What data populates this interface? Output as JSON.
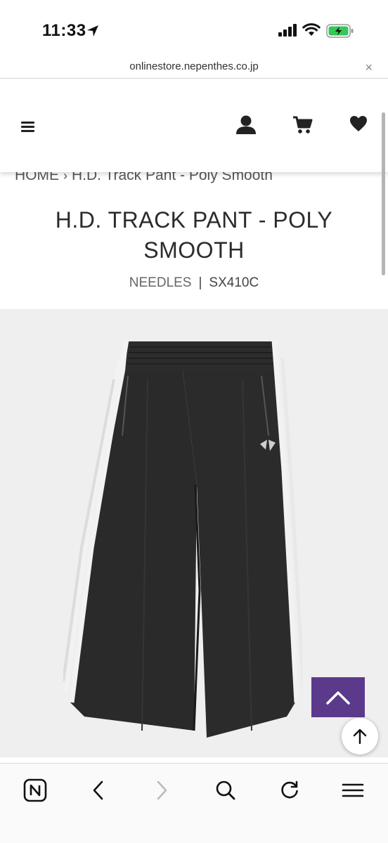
{
  "status_bar": {
    "time": "11:33"
  },
  "url_bar": {
    "domain": "onlinestore.nepenthes.co.jp",
    "close_glyph": "×"
  },
  "header": {
    "menu_icon": "hamburger-menu-icon",
    "account_icon": "user-icon",
    "cart_icon": "cart-icon",
    "wishlist_icon": "heart-icon"
  },
  "breadcrumb": {
    "home": "HOME",
    "separator": "›",
    "current": "H.D. Track Pant - Poly Smooth"
  },
  "product": {
    "title": "H.D. TRACK PANT - POLY SMOOTH",
    "brand": "NEEDLES",
    "separator": "|",
    "sku": "SX410C",
    "image_bg": "#efefef"
  },
  "colors": {
    "accent": "#5b3a8c",
    "pant": "#2a2a2a",
    "stripe": "#f2f2f2"
  },
  "toolbar": {
    "items": [
      "app-icon",
      "back-icon",
      "forward-icon",
      "search-icon",
      "reload-icon",
      "menu-icon"
    ]
  }
}
